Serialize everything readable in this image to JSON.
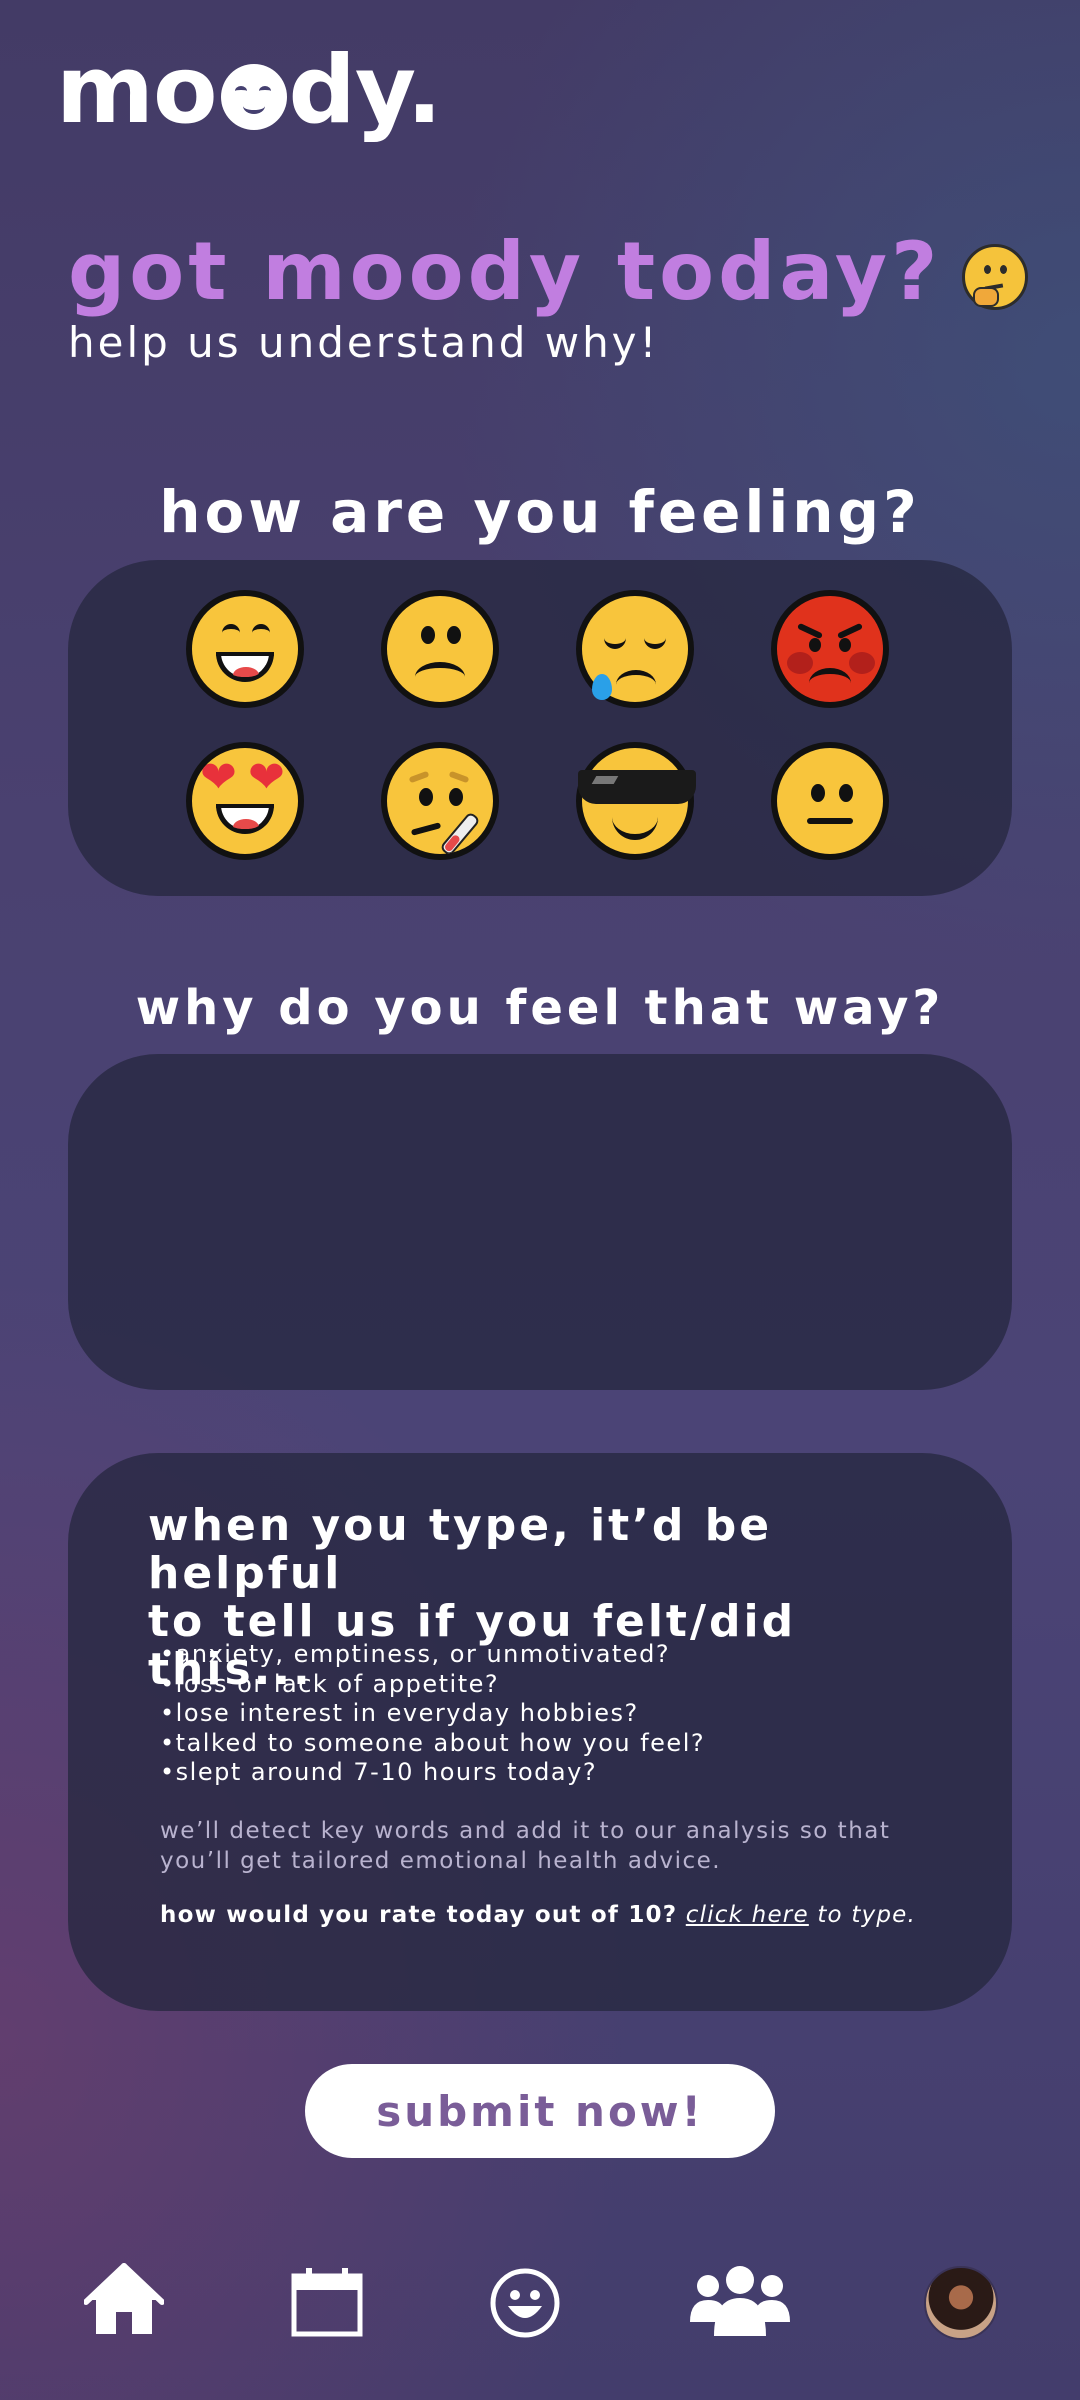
{
  "app": {
    "logo_pre": "mo",
    "logo_post": "dy."
  },
  "hero": {
    "title": "got moody today?",
    "subtitle": "help us understand why!",
    "title_icon": "thinking-face-emoji"
  },
  "mood": {
    "heading": "how are you feeling?",
    "options": [
      {
        "name": "grinning",
        "icon": "grinning-face-emoji"
      },
      {
        "name": "frowning",
        "icon": "frowning-face-emoji"
      },
      {
        "name": "sad-crying",
        "icon": "sad-face-with-tear-emoji"
      },
      {
        "name": "angry",
        "icon": "angry-face-emoji"
      },
      {
        "name": "in-love",
        "icon": "heart-eyes-emoji"
      },
      {
        "name": "sick",
        "icon": "face-with-thermometer-emoji"
      },
      {
        "name": "cool",
        "icon": "sunglasses-face-emoji"
      },
      {
        "name": "neutral",
        "icon": "neutral-face-emoji"
      }
    ]
  },
  "reason": {
    "heading": "why do you feel that way?",
    "value": ""
  },
  "tips": {
    "title": "when you type, it’d be helpful\nto tell us if you felt/did this...",
    "items": [
      "anxiety, emptiness, or unmotivated?",
      "loss or lack of appetite?",
      "lose interest in everyday hobbies?",
      "talked to someone about how you feel?",
      "slept around 7-10 hours today?"
    ],
    "detect_note": "we’ll detect key words and add it to our analysis so that you’ll get tailored emotional health advice.",
    "rate_question": "how would you rate today out of 10?",
    "rate_link": "click here",
    "rate_after": "to type."
  },
  "submit": {
    "label": "submit now!"
  },
  "nav": {
    "items": [
      "home-icon",
      "calendar-icon",
      "mood-icon",
      "community-icon",
      "profile-avatar"
    ]
  }
}
